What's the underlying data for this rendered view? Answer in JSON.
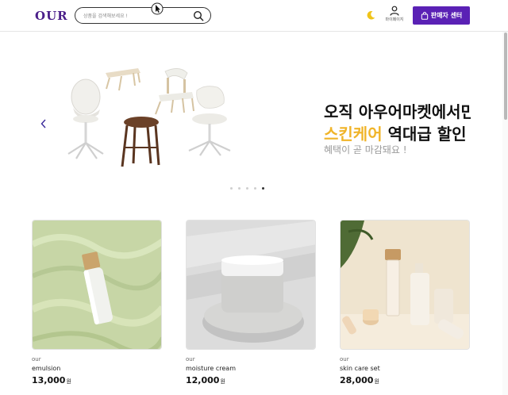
{
  "header": {
    "logo": "OUR",
    "search_placeholder": "상품을 검색해보세요 !",
    "mypage_label": "마이페이지",
    "seller_button_label": "판매자 센터",
    "brand_color": "#5a21b5"
  },
  "banner": {
    "line1": "오직 아우어마켓에서만",
    "line2_highlight": "스킨케어",
    "line2_rest": "역대급 할인",
    "line3": "혜택이 곧 마감돼요 !",
    "highlight_color": "#f0b429",
    "slide_count": 5,
    "active_slide": 4
  },
  "products": [
    {
      "brand": "our",
      "name": "emulsion",
      "price": "13,000",
      "currency": "원"
    },
    {
      "brand": "our",
      "name": "moisture cream",
      "price": "12,000",
      "currency": "원"
    },
    {
      "brand": "our",
      "name": "skin care set",
      "price": "28,000",
      "currency": "원"
    }
  ],
  "icons": [
    "search-icon",
    "moon-icon",
    "user-icon",
    "shopping-bag-icon",
    "chevron-left-icon",
    "cursor-icon"
  ]
}
